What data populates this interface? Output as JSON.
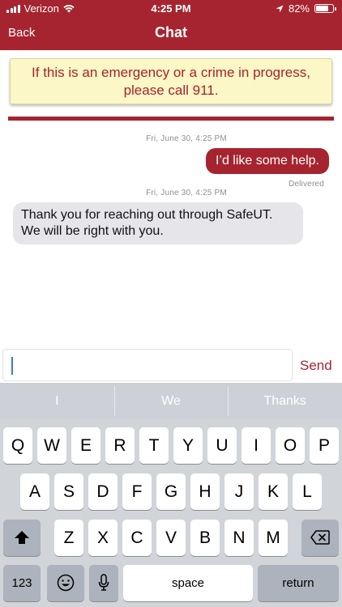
{
  "status_bar": {
    "carrier": "Verizon",
    "time": "4:25 PM",
    "battery": "82%",
    "battery_level": 0.82
  },
  "nav": {
    "back_label": "Back",
    "title": "Chat"
  },
  "banner": {
    "text": "If this is an emergency or a crime in progress, please call 911."
  },
  "messages": [
    {
      "timestamp": "Fri, June 30, 4:25 PM",
      "text": "I’d like some help.",
      "direction": "outgoing",
      "status": "Delivered"
    },
    {
      "timestamp": "Fri, June 30, 4:25 PM",
      "text": "Thank you for reaching out through SafeUT. We will be right with you.",
      "direction": "incoming"
    }
  ],
  "composer": {
    "value": "",
    "send_label": "Send"
  },
  "keyboard": {
    "suggestions": [
      "I",
      "We",
      "Thanks"
    ],
    "row1": [
      "Q",
      "W",
      "E",
      "R",
      "T",
      "Y",
      "U",
      "I",
      "O",
      "P"
    ],
    "row2": [
      "A",
      "S",
      "D",
      "F",
      "G",
      "H",
      "J",
      "K",
      "L"
    ],
    "row3": [
      "Z",
      "X",
      "C",
      "V",
      "B",
      "N",
      "M"
    ],
    "numbers_label": "123",
    "space_label": "space",
    "return_label": "return"
  },
  "colors": {
    "brand": "#a6242f",
    "banner_bg": "#fcf7c6",
    "incoming_bubble": "#e5e5ea"
  }
}
